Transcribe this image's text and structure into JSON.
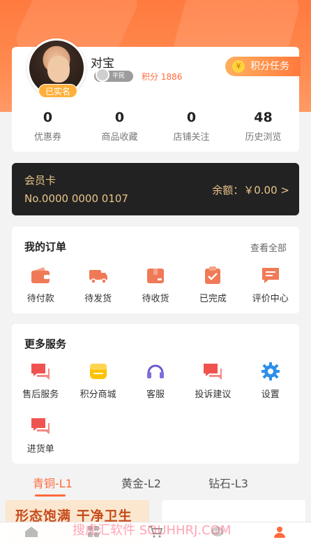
{
  "profile": {
    "username": "对宝",
    "verified_label": "已实名",
    "level_label": "平民",
    "points_text": "积分 1886",
    "task_button": "积分任务",
    "stats": [
      {
        "value": "0",
        "label": "优惠券"
      },
      {
        "value": "0",
        "label": "商品收藏"
      },
      {
        "value": "0",
        "label": "店铺关注"
      },
      {
        "value": "48",
        "label": "历史浏览"
      }
    ]
  },
  "member_card": {
    "title": "会员卡",
    "number": "No.0000 0000 0107",
    "balance": "余额：￥0.00 >"
  },
  "orders": {
    "title": "我的订单",
    "more": "查看全部",
    "items": [
      {
        "label": "待付款",
        "icon": "wallet-icon"
      },
      {
        "label": "待发货",
        "icon": "truck-icon"
      },
      {
        "label": "待收货",
        "icon": "package-icon"
      },
      {
        "label": "已完成",
        "icon": "clipboard-check-icon"
      },
      {
        "label": "评价中心",
        "icon": "comment-icon"
      }
    ]
  },
  "services": {
    "title": "更多服务",
    "items": [
      {
        "label": "售后服务",
        "icon": "chat-bubbles-icon"
      },
      {
        "label": "积分商城",
        "icon": "shop-icon"
      },
      {
        "label": "客服",
        "icon": "headset-icon"
      },
      {
        "label": "投诉建议",
        "icon": "chat-bubbles-icon"
      },
      {
        "label": "设置",
        "icon": "gear-icon"
      },
      {
        "label": "进货单",
        "icon": "chat-bubbles-icon"
      }
    ]
  },
  "tabs": [
    "青铜-L1",
    "黄金-L2",
    "钻石-L3"
  ],
  "banner": {
    "text": "形态饱满 干净卫生"
  },
  "watermark": "搜虎汇软件 SOUHHRJ.COM",
  "colors": {
    "accent": "#ff6a3c",
    "member_card_bg": "#222222",
    "member_gold": "#e8c58a"
  }
}
